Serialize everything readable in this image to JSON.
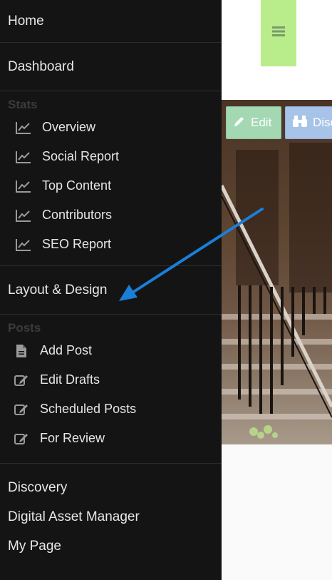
{
  "sidebar": {
    "home": "Home",
    "dashboard": "Dashboard",
    "stats": {
      "heading": "Stats",
      "items": [
        {
          "label": "Overview",
          "icon": "line-chart-icon"
        },
        {
          "label": "Social Report",
          "icon": "line-chart-icon"
        },
        {
          "label": "Top Content",
          "icon": "line-chart-icon"
        },
        {
          "label": "Contributors",
          "icon": "line-chart-icon"
        },
        {
          "label": "SEO Report",
          "icon": "line-chart-icon"
        }
      ]
    },
    "layout_design": "Layout & Design",
    "posts": {
      "heading": "Posts",
      "items": [
        {
          "label": "Add Post",
          "icon": "document-icon"
        },
        {
          "label": "Edit Drafts",
          "icon": "edit-square-icon"
        },
        {
          "label": "Scheduled Posts",
          "icon": "edit-square-icon"
        },
        {
          "label": "For Review",
          "icon": "edit-square-icon"
        }
      ]
    },
    "bottom": [
      "Discovery",
      "Digital Asset Manager",
      "My Page"
    ]
  },
  "main": {
    "menu_icon": "hamburger-icon",
    "edit_label": "Edit",
    "discover_label": "Disc"
  },
  "annotation": {
    "arrow_color": "#1a7fd8"
  },
  "colors": {
    "sidebar_bg": "#141414",
    "menu_btn_bg": "#b9ec8a",
    "edit_btn_bg": "#a3d8b3",
    "discover_btn_bg": "#a8c3e8"
  }
}
